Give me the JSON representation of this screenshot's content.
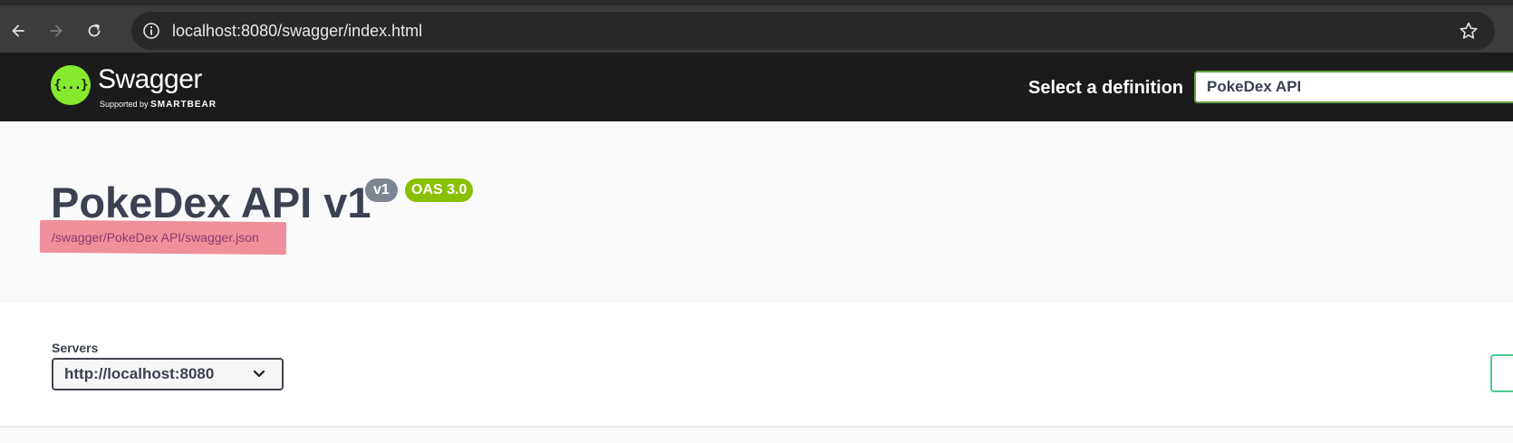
{
  "browser": {
    "url": "localhost:8080/swagger/index.html"
  },
  "topbar": {
    "logo_text": "Swagger",
    "logo_mark": "{...}",
    "logo_supported": "Supported by",
    "logo_brand": "SMARTBEAR",
    "definition_label": "Select a definition",
    "definition_value": "PokeDex API"
  },
  "info": {
    "title": "PokeDex API v1",
    "version_badge": "v1",
    "oas_badge": "OAS 3.0",
    "spec_url": "/swagger/PokeDex API/swagger.json"
  },
  "servers": {
    "label": "Servers",
    "selected": "http://localhost:8080"
  },
  "colors": {
    "swagger_green": "#85ea2d",
    "topbar_bg": "#1b1b1b",
    "oas_badge": "#89bf04",
    "version_badge": "#7d8492",
    "highlight": "#f08f9c"
  }
}
